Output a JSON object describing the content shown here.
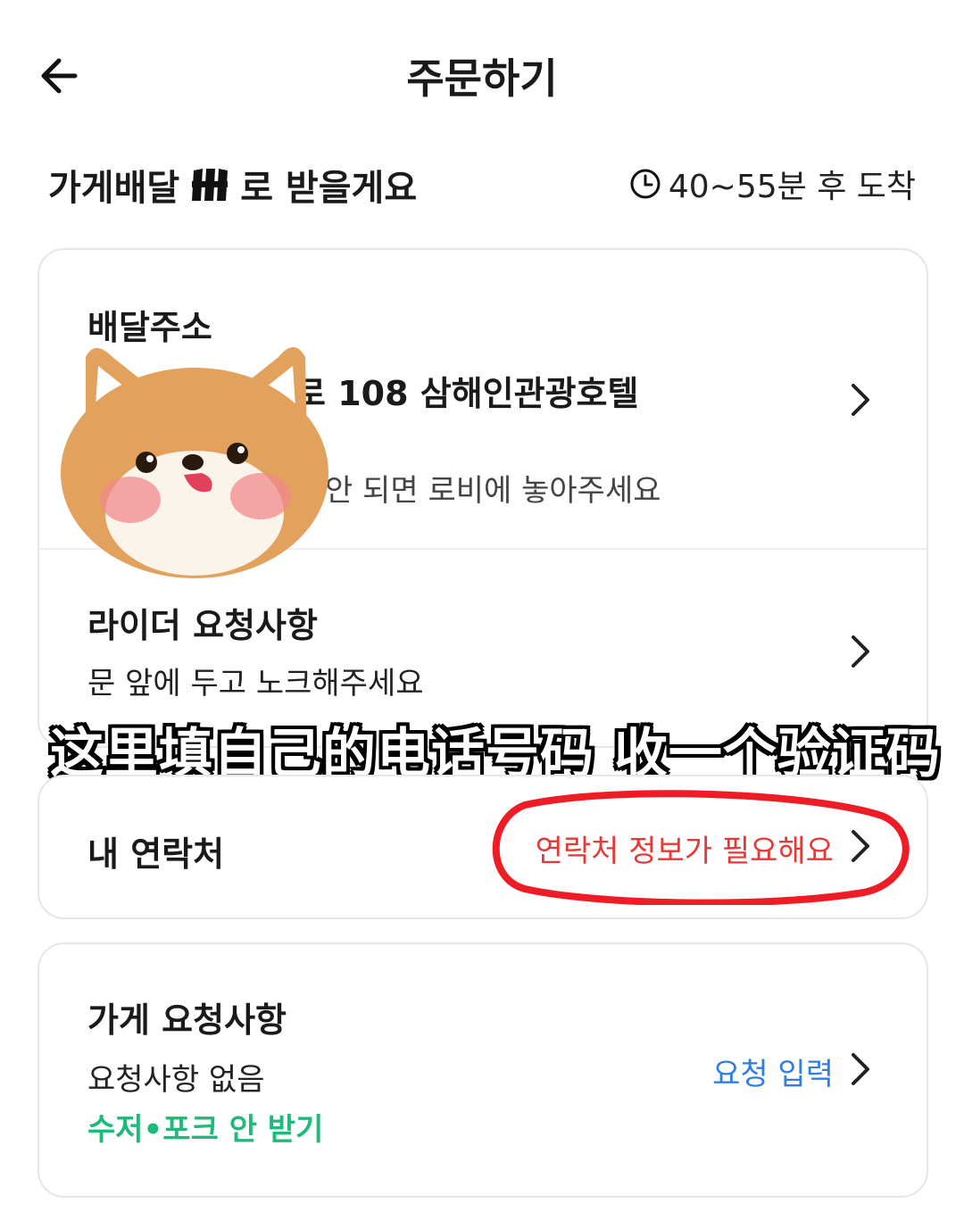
{
  "header": {
    "title": "주문하기",
    "back_icon": "arrow-left-icon"
  },
  "delivery": {
    "prefix": "가게배달",
    "logo_icon": "brand-logo-icon",
    "suffix": "로 받을게요",
    "eta_icon": "clock-icon",
    "eta": "40~55분 후 도착"
  },
  "address_card": {
    "title": "배달주소",
    "address_visible": "로 108 삼해인관광호텔",
    "note_visible": "안 되면 로비에 놓아주세요"
  },
  "rider_card": {
    "title": "라이더 요청사항",
    "value": "문 앞에 두고 노크해주세요"
  },
  "overlay": {
    "caption": "这里填自己的电话号码 收一个验证码"
  },
  "contact_card": {
    "label": "내 연락처",
    "warning": "연락처 정보가 필요해요",
    "highlight_color": "#ee1c25"
  },
  "store_card": {
    "title": "가게 요청사항",
    "value": "요청사항 없음",
    "cutlery": "수저•포크 안 받기",
    "link": "요청 입력"
  },
  "colors": {
    "warning": "#e53935",
    "link": "#2f7ee6",
    "green": "#1fb97a",
    "sticker": "#e3a15e"
  }
}
